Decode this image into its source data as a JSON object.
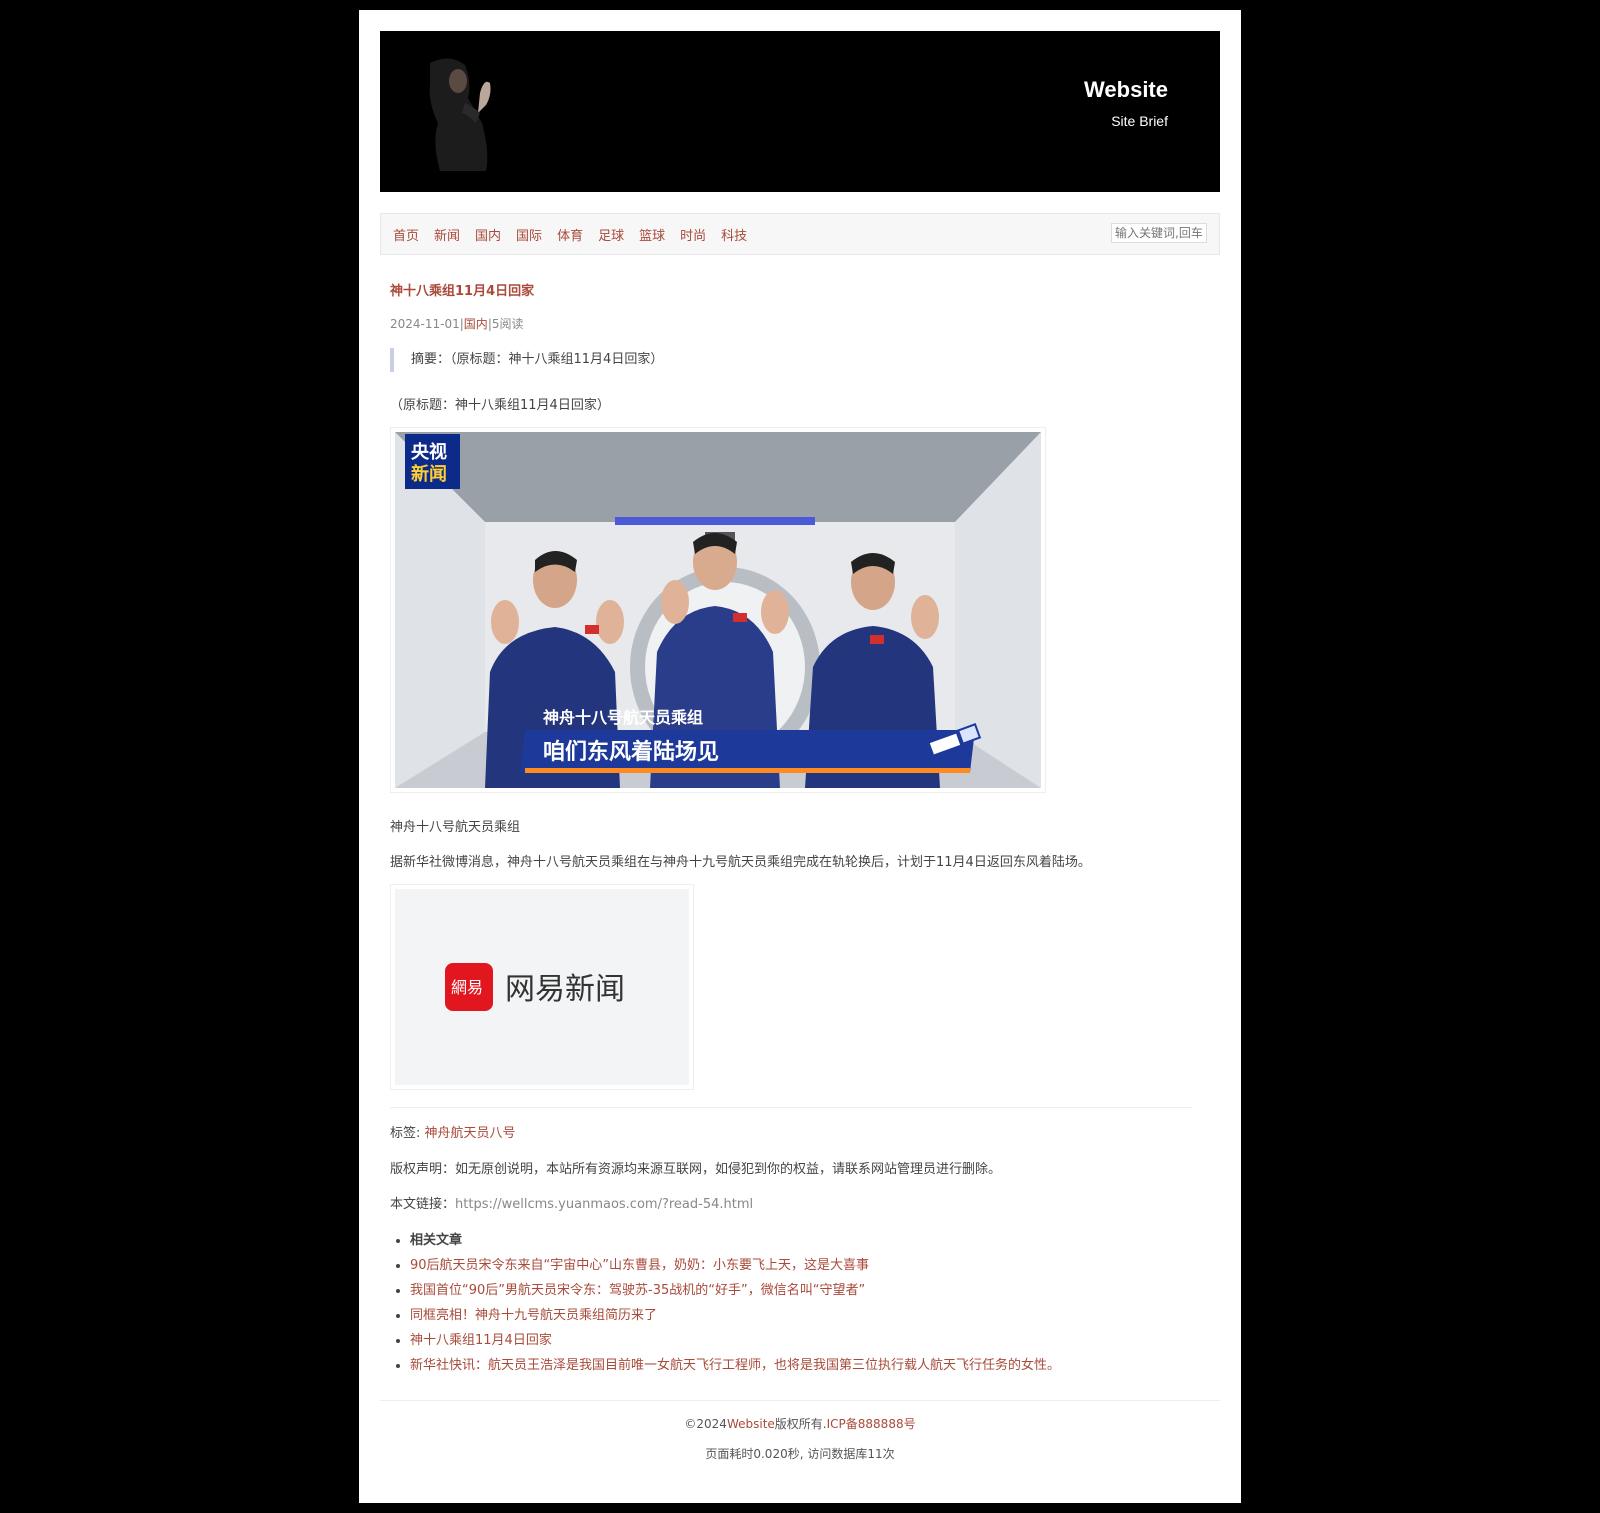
{
  "header": {
    "site_title": "Website",
    "site_brief": "Site Brief"
  },
  "nav": {
    "items": [
      "首页",
      "新闻",
      "国内",
      "国际",
      "体育",
      "足球",
      "篮球",
      "时尚",
      "科技"
    ],
    "search_placeholder": "输入关键词,回车"
  },
  "article": {
    "title": "神十八乘组11月4日回家",
    "meta": {
      "date": "2024-11-01",
      "sep1": "|",
      "category": "国内",
      "sep2": "|",
      "reads": "5阅读"
    },
    "summary": "摘要：（原标题：神十八乘组11月4日回家）",
    "lead": "（原标题：神十八乘组11月4日回家）",
    "image1": {
      "logo_line1": "央视",
      "logo_line2": "新闻",
      "caption_small": "神舟十八号航天员乘组",
      "caption_big": "咱们东风着陆场见"
    },
    "image_caption": "神舟十八号航天员乘组",
    "body": "据新华社微博消息，神舟十八号航天员乘组在与神舟十九号航天员乘组完成在轨轮换后，计划于11月4日返回东风着陆场。",
    "image2": {
      "logo_text": "网易新闻",
      "badge_text": "網易"
    },
    "tags_label": "标签:",
    "tag": "神舟航天员八号",
    "copyright": "版权声明：如无原创说明，本站所有资源均来源互联网，如侵犯到你的权益，请联系网站管理员进行删除。",
    "link_label": "本文链接：",
    "link_url": "https://wellcms.yuanmaos.com/?read-54.html"
  },
  "related": {
    "heading": "相关文章",
    "items": [
      "90后航天员宋令东来自“宇宙中心”山东曹县，奶奶：小东要飞上天，这是大喜事",
      "我国首位“90后”男航天员宋令东：驾驶苏-35战机的“好手”，微信名叫“守望者”",
      "同框亮相！神舟十九号航天员乘组简历来了",
      "神十八乘组11月4日回家",
      "新华社快讯：航天员王浩泽是我国目前唯一女航天飞行工程师，也将是我国第三位执行载人航天飞行任务的女性。"
    ]
  },
  "footer": {
    "prefix": "©2024",
    "site": "Website",
    "rights": "版权所有.",
    "icp": "ICP备888888号",
    "stats": "页面耗时0.020秒, 访问数据库11次"
  }
}
